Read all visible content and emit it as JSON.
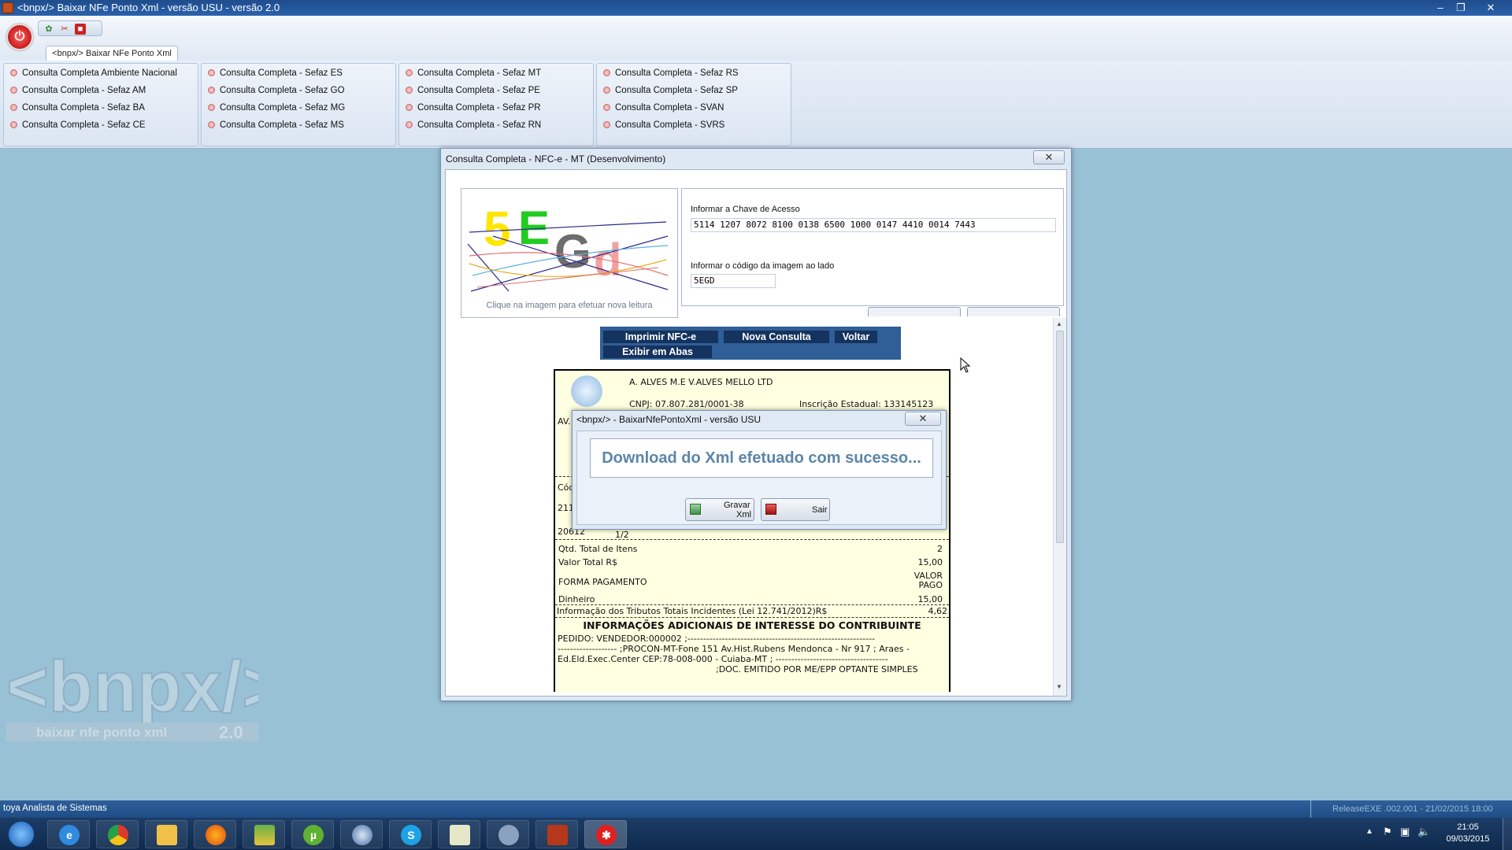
{
  "window": {
    "title": "<bnpx/> Baixar NFe Ponto Xml - versão USU - versão 2.0"
  },
  "tab": {
    "label": "<bnpx/> Baixar NFe Ponto Xml"
  },
  "ribbon": {
    "groups": [
      {
        "items": [
          "Consulta Completa Ambiente Nacional",
          "Consulta Completa - Sefaz AM",
          "Consulta Completa - Sefaz BA",
          "Consulta Completa - Sefaz CE"
        ]
      },
      {
        "items": [
          "Consulta Completa - Sefaz ES",
          "Consulta Completa - Sefaz GO",
          "Consulta Completa - Sefaz MG",
          "Consulta Completa - Sefaz MS"
        ]
      },
      {
        "items": [
          "Consulta Completa - Sefaz MT",
          "Consulta Completa - Sefaz PE",
          "Consulta Completa - Sefaz PR",
          "Consulta Completa - Sefaz RN"
        ]
      },
      {
        "items": [
          "Consulta Completa - Sefaz RS",
          "Consulta Completa - Sefaz SP",
          "Consulta Completa - SVAN",
          "Consulta Completa - SVRS"
        ]
      }
    ]
  },
  "dialog": {
    "title": "Consulta Completa - NFC-e - MT (Desenvolvimento)",
    "captcha_text": "5EGd",
    "captcha_note": "Clique na imagem para efetuar nova leitura",
    "key_label": "Informar a Chave de Acesso",
    "key_value": "5114 1207 8072 8100 0138 6500 1000 0147 4410 0014 7443",
    "code_label": "Informar o código da imagem ao lado",
    "code_value": "5EGD",
    "buttons": {
      "print": "Imprimir NFC-e",
      "new": "Nova Consulta",
      "back": "Voltar",
      "tabs": "Exibir em Abas"
    }
  },
  "receipt": {
    "company": "A. ALVES M.E V.ALVES MELLO LTD",
    "cnpj": "CNPJ: 07.807.281/0001-38",
    "ie": "Inscrição Estadual: 133145123",
    "addr_frag": "AV.",
    "cod_frag": "Cód",
    "row1_frag": "211",
    "row2_frag": "20612",
    "row2_sub": "1/2",
    "qtd_label": "Qtd. Total de Itens",
    "qtd_value": "2",
    "total_label": "Valor Total R$",
    "total_value": "15,00",
    "pay_label": "FORMA PAGAMENTO",
    "pay_header1": "VALOR",
    "pay_header2": "PAGO",
    "cash_label": "Dinheiro",
    "cash_value": "15,00",
    "tributos_label": "Informação dos Tributos Totais Incidentes (Lei 12.741/2012)R$",
    "tributos_value": "4,62",
    "info_title": "INFORMAÇÕES ADICIONAIS DE INTERESSE DO CONTRIBUINTE",
    "info_line1": "PEDIDO: VENDEDOR:000002 ;------------------------------------------------------------",
    "info_line2": "------------------- ;PROCON-MT-Fone 151 Av.Hist.Rubens Mendonca - Nr 917 ; Araes -",
    "info_line3": "Ed.Eld.Exec.Center CEP:78-008-000 - Cuiaba-MT ; ------------------------------------",
    "info_line4": ";DOC. EMITIDO POR ME/EPP OPTANTE SIMPLES"
  },
  "message_box": {
    "title": "<bnpx/> - BaixarNfePontoXml - versão USU",
    "text": "Download do Xml efetuado com sucesso...",
    "save_label_1": "Gravar",
    "save_label_2": "Xml",
    "exit_label": "Sair"
  },
  "logo": {
    "main": "<bnpx/>",
    "sub": "baixar nfe ponto xml",
    "version": "2.0"
  },
  "statusbar": {
    "left": "toya Analista de Sistemas",
    "right": "ReleaseEXE .002.001 - 21/02/2015 18:00"
  },
  "clock": {
    "time": "21:05",
    "date": "09/03/2015"
  },
  "taskbar": {
    "icons": [
      "start-orb",
      "internet-explorer-icon",
      "chrome-icon",
      "file-explorer-icon",
      "firefox-icon",
      "stack-app-icon",
      "utorrent-icon",
      "thunderbird-icon",
      "skype-icon",
      "notepad-icon",
      "network-tool-icon",
      "filezilla-icon",
      "red-splash-app-icon"
    ]
  },
  "colors": {
    "accent": "#2f5f96",
    "desktop": "#99c1d6",
    "receipt_bg": "#ffffe1"
  }
}
